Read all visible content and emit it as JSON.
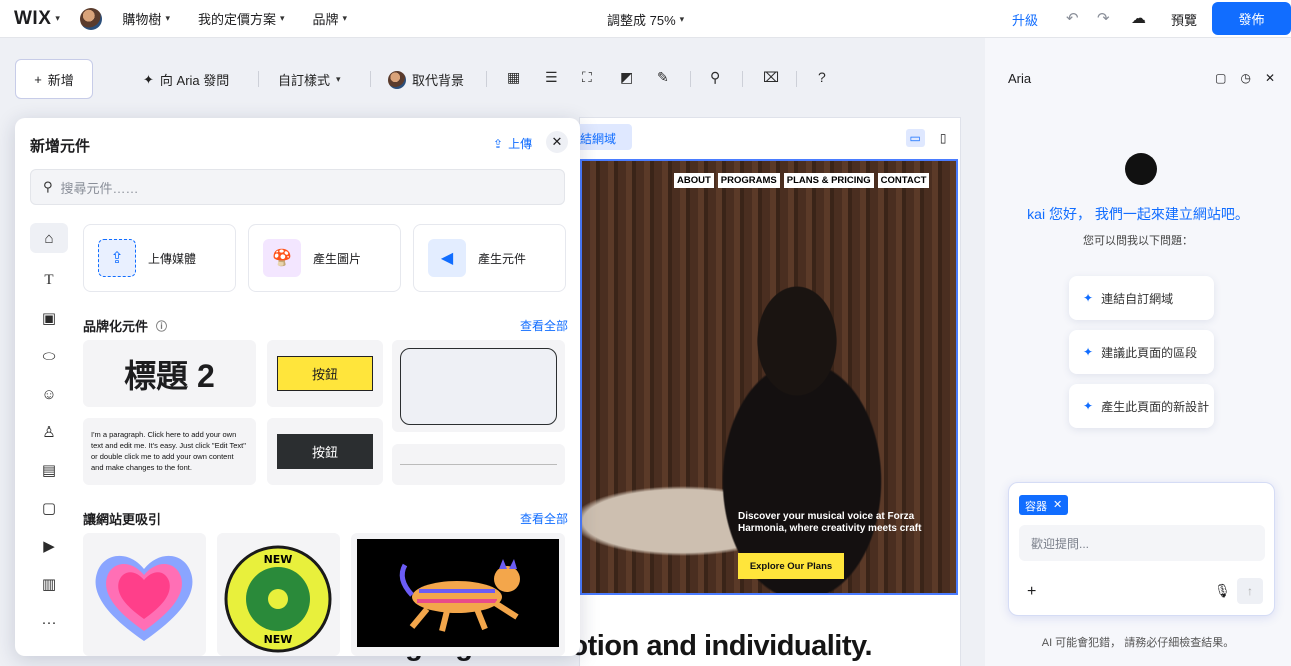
{
  "topbar": {
    "logo": "WIX",
    "nav": [
      "購物樹",
      "我的定價方案",
      "品牌"
    ],
    "zoom": "調整成 75%",
    "upgrade": "升級",
    "preview": "預覽",
    "publish": "發佈"
  },
  "toolbar": {
    "add": "新增",
    "ask_aria": "向 Aria 發問",
    "custom_style": "自訂樣式",
    "replace_bg": "取代背景",
    "help": "?"
  },
  "canvas": {
    "domain_chip": "結網域",
    "nav": [
      "ABOUT",
      "PROGRAMS",
      "PLANS & PRICING",
      "CONTACT"
    ],
    "tagline": "Discover your musical voice at Forza Harmonia, where creativity meets craft",
    "cta": "Explore Our Plans",
    "headline": "We believe music is a language of emotion and individuality."
  },
  "panel": {
    "title": "新增元件",
    "upload": "上傳",
    "search_placeholder": "搜尋元件……",
    "quick_cards": [
      "上傳媒體",
      "產生圖片",
      "產生元件"
    ],
    "branded_title": "品牌化元件",
    "see_all": "查看全部",
    "heading_sample": "標題 2",
    "button_sample": "按鈕",
    "paragraph_sample": "I'm a paragraph. Click here to add your own text and edit me. It's easy. Just click \"Edit Text\" or double click me to add your own content and make changes to the font.",
    "attract_title": "讓網站更吸引",
    "badge_text": "NEW"
  },
  "aria": {
    "title": "Aria",
    "greeting": "kai 您好， 我們一起來建立網站吧。",
    "sub": "您可以問我以下問題：",
    "suggestions": [
      "連結自訂網域",
      "建議此頁面的區段",
      "產生此頁面的新設計"
    ],
    "chip": "容器",
    "input_placeholder": "歡迎提問...",
    "disclaimer": "AI 可能會犯錯， 請務必仔細檢查結果。"
  },
  "colors": {
    "accent": "#116dff",
    "yellow": "#ffe53b"
  }
}
